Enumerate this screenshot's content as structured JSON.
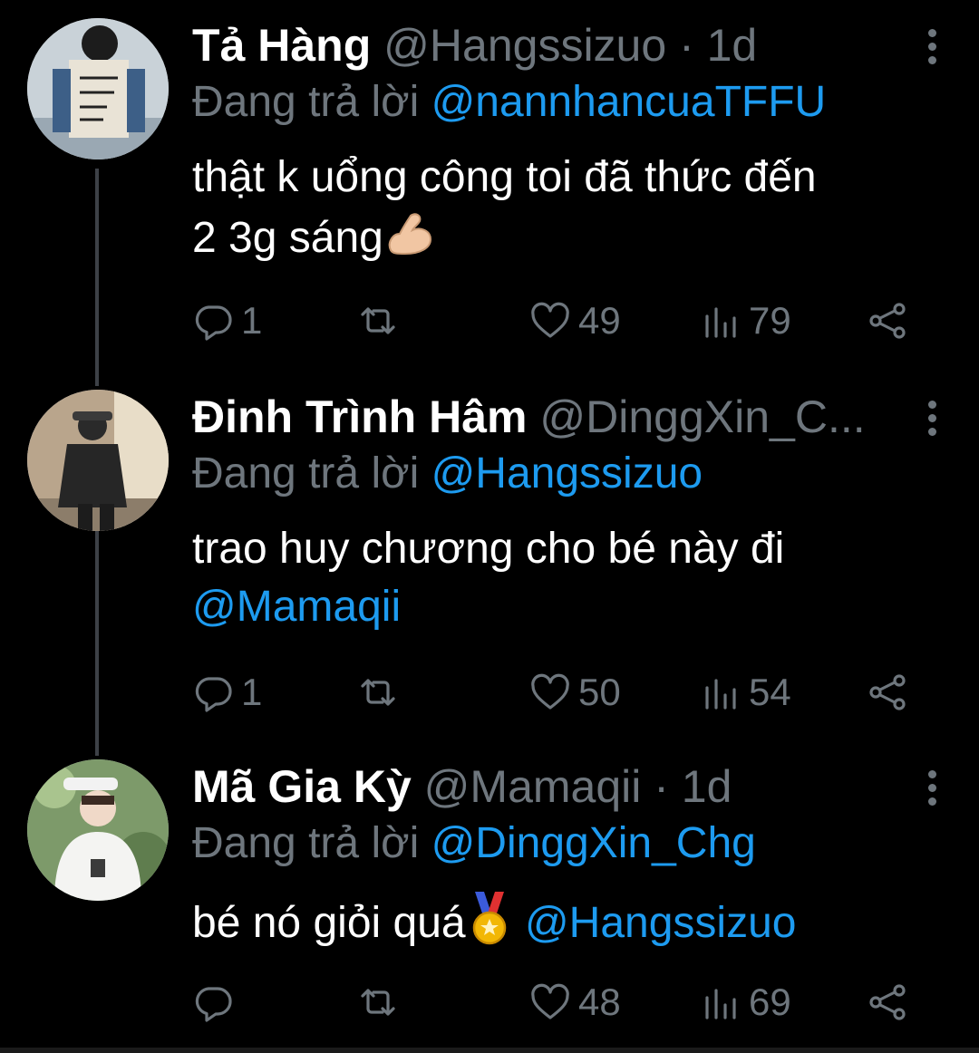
{
  "colors": {
    "background": "#000000",
    "accent": "#1d9bf0",
    "muted": "#6e767d",
    "thread": "#3d4147"
  },
  "tweets": [
    {
      "name": "Tả Hàng",
      "handle": "@Hangssizuo",
      "dot": " · ",
      "time": "1d",
      "reply_prefix": "Đang trả lời ",
      "reply_to": "@nannhancuaTFFU",
      "text_line1": "thật k uổng công toi đã thức đến",
      "text_line2": "2 3g sáng",
      "emoji": "flexed-biceps-icon",
      "replies": "1",
      "retweets": "",
      "likes": "49",
      "views": "79"
    },
    {
      "name": "Đinh Trình Hâm",
      "handle": "@DinggXin_C...",
      "dot": "",
      "time": "",
      "reply_prefix": "Đang trả lời ",
      "reply_to": "@Hangssizuo",
      "text_line1": "trao huy chương cho bé này đi",
      "mention_line2": "@Mamaqii",
      "replies": "1",
      "retweets": "",
      "likes": "50",
      "views": "54"
    },
    {
      "name": "Mã Gia Kỳ",
      "handle": "@Mamaqii",
      "dot": " · ",
      "time": "1d",
      "reply_prefix": "Đang trả lời ",
      "reply_to": "@DinggXin_Chg",
      "text_line1": "bé nó giỏi quá",
      "emoji": "medal-icon",
      "mention_after": "@Hangssizuo",
      "replies": "",
      "retweets": "",
      "likes": "48",
      "views": "69"
    }
  ]
}
